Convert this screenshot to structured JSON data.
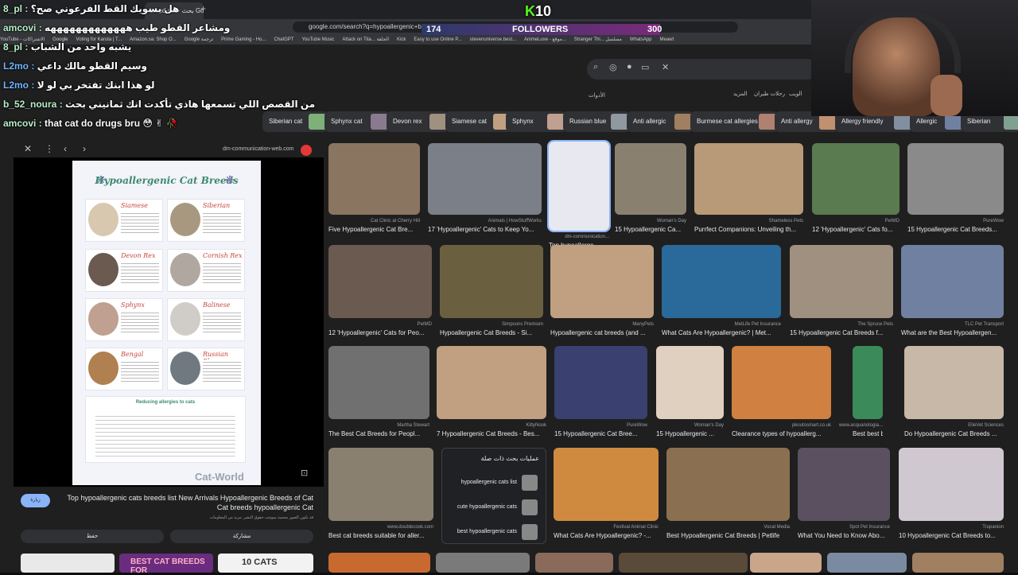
{
  "browser": {
    "tab_title": "breed cat - بحث Google",
    "url": "google.com/search?q=hypoallergenic+breed+cat&tbm=isch",
    "bookmarks": [
      "YouTube - الاشتراكات",
      "Google",
      "Voting for Karuta | T...",
      "Amazon.sa: Shop O...",
      "Google ترجمة",
      "Prime Gaming - Ho...",
      "ChatGPT",
      "YouTube Music",
      "Attack on Tita... الحلقة",
      "Kick",
      "Easy to use Online P...",
      "stevenuniverse.best...",
      "AnimeLuxe - موقع...",
      "Stranger Thi... مسلسل",
      "WhatsApp",
      "Meawt"
    ]
  },
  "stream": {
    "logo_k": "K",
    "logo_num": "10",
    "followers_left": "174",
    "followers_label": "FOLLOWERS",
    "followers_right": "300"
  },
  "chat": [
    {
      "user": "8_pl :",
      "text": "هل بسويك القط الفرعوني صح؟"
    },
    {
      "user": "amcovi :",
      "text": "ومشاعر القطو طيب هههههههههههههه"
    },
    {
      "user": "8_pl :",
      "text": "يشبه واحد من الشباب"
    },
    {
      "user": "L2mo :",
      "text": "وسيم القطو مالك داعي"
    },
    {
      "user": "L2mo :",
      "text": "لو هذا ابنك تفتخر بي لو لا"
    },
    {
      "user": "b_52_noura :",
      "text": "من القصص اللي تسمعها هاذي تأكدت انك ثمانيني بحث"
    },
    {
      "user": "amcovi :",
      "text": "that cat do drugs bru 😳 ✌ 🥀"
    }
  ],
  "filters": [
    "الويب",
    "رحلات طيران",
    "المزيد",
    "الأدوات"
  ],
  "chips": [
    "Siberian cat",
    "Sphynx cat",
    "Devon rex",
    "Siamese cat",
    "Sphynx",
    "Russian blue",
    "Anti allergic",
    "Burmese cat allergies",
    "Anti allergy",
    "Allergy friendly",
    "Allergic",
    "Siberian"
  ],
  "preview": {
    "site": "dm-communication-web.com",
    "infographic_title": "Hypoallergenic Cat Breeds",
    "breeds": [
      "Siamese",
      "Siberian",
      "Devon Rex",
      "Cornish Rex",
      "Sphynx",
      "Balinese",
      "Bengal",
      "Russian Blue"
    ],
    "reducing_title": "Reducing allergies to cats",
    "watermark": "Cat-World",
    "badge": "زيارة",
    "title": "Top hypoallergenic cats breeds list New Arrivals Hypoallergenic Breeds of Cat Cat breeds hypoallergenic Cat",
    "note": "قد تكون الصور محمية بموجب حقوق النشر. مزيد من المعلومات",
    "save": "حفظ",
    "share": "مشاركة"
  },
  "results": [
    {
      "src": "Cat Clinic at Cherry Hill",
      "cap": "Five Hypoallergenic Cat Bre..."
    },
    {
      "src": "Animals | HowStuffWorks",
      "cap": "17 'Hypoallergenic' Cats to Keep Yo..."
    },
    {
      "src": "dm-communication...",
      "cap": "Top hypoallerge..."
    },
    {
      "src": "Woman's Day",
      "cap": "15 Hypoallergenic Ca..."
    },
    {
      "src": "Shameless Pets",
      "cap": "Purrfect Companions: Unveiling th..."
    },
    {
      "src": "PetMD",
      "cap": "12 'Hypoallergenic' Cats fo..."
    },
    {
      "src": "PureWow",
      "cap": "15 Hypoallergenic Cat Breeds..."
    },
    {
      "src": "PetMD",
      "cap": "12 'Hypoallergenic' Cats for Peo..."
    },
    {
      "src": "Simpsons Premium",
      "cap": "Hypoallergenic Cat Breeds - Si..."
    },
    {
      "src": "ManyPets",
      "cap": "Hypoallergenic cat breeds (and ..."
    },
    {
      "src": "MetLife Pet Insurance",
      "cap": "What Cats Are Hypoallergenic? | Met..."
    },
    {
      "src": "The Spruce Pets",
      "cap": "15 Hypoallergenic Cat Breeds f..."
    },
    {
      "src": "TLC Pet Transport",
      "cap": "What are the Best Hypoallergen..."
    },
    {
      "src": "Martha Stewart",
      "cap": "The Best Cat Breeds for Peopl..."
    },
    {
      "src": "KittyNook",
      "cap": "7 Hypoallergenic Cat Breeds - Bes..."
    },
    {
      "src": "PureWow",
      "cap": "15 Hypoallergenic Cat Bree..."
    },
    {
      "src": "Woman's Day",
      "cap": "15 Hypoallergenic ..."
    },
    {
      "src": "pkoutosmart.co.uk",
      "cap": "Clearance types of hypoallerg..."
    },
    {
      "src": "www.acquanologia...",
      "cap": "Best best breed ..."
    },
    {
      "src": "ElleVet Sciences",
      "cap": "Do Hypoallergenic Cat Breeds ..."
    },
    {
      "src": "www.doublecook.com",
      "cap": "Best cat breeds suitable for aller..."
    },
    {
      "src": "Festival Animal Clinic",
      "cap": "What Cats Are Hypoallergenic? -..."
    },
    {
      "src": "Vocal Media",
      "cap": "Best Hypoallergenic Cat Breeds | Petlife"
    },
    {
      "src": "Spot Pet Insurance",
      "cap": "What You Need to Know Abo..."
    },
    {
      "src": "Trupanion",
      "cap": "10 Hypoallergenic Cat Breeds to..."
    }
  ],
  "related": {
    "heading": "عمليات بحث ذات صلة",
    "items": [
      "hypoallergenic cats list",
      "cute hypoallergenic cats",
      "best hypoallergenic cats"
    ]
  },
  "bottom_thumbs": [
    "BEST CAT BREEDS FOR",
    "10 CATS"
  ]
}
